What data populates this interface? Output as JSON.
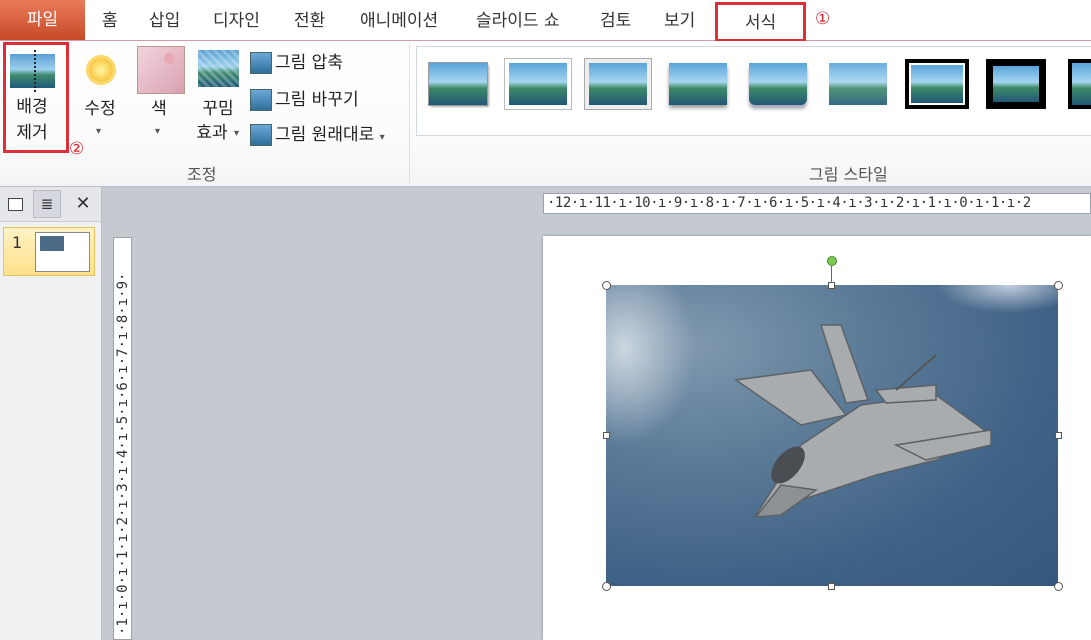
{
  "tabs": {
    "file": "파일",
    "home": "홈",
    "insert": "삽입",
    "design": "디자인",
    "transitions": "전환",
    "animations": "애니메이션",
    "slideshow": "슬라이드 쇼",
    "review": "검토",
    "view": "보기",
    "format": "서식"
  },
  "annotations": {
    "step1": "①",
    "step2": "②",
    "highlight_color": "#dc2f3a"
  },
  "ribbon": {
    "remove_bg_line1": "배경",
    "remove_bg_line2": "제거",
    "corrections": "수정",
    "color": "색",
    "artistic_line1": "꾸밈",
    "artistic_line2": "효과",
    "compress": "그림 압축",
    "change": "그림 바꾸기",
    "reset": "그림 원래대로",
    "adjust_group": "조정",
    "styles_group": "그림 스타일",
    "dropdown_glyph": "▾"
  },
  "left_panel": {
    "slide_number": "1",
    "close_glyph": "✕"
  },
  "rulers": {
    "horizontal": "·12·ı·11·ı·10·ı·9·ı·8·ı·7·ı·6·ı·5·ı·4·ı·3·ı·2·ı·1·ı·0·ı·1·ı·2",
    "vertical": "·1·ı·0·ı·1·ı·2·ı·3·ı·4·ı·5·ı·6·ı·7·ı·8·ı·9·"
  },
  "colors": {
    "file_tab": "#c84a27",
    "rotation_handle": "#7cc94f"
  }
}
